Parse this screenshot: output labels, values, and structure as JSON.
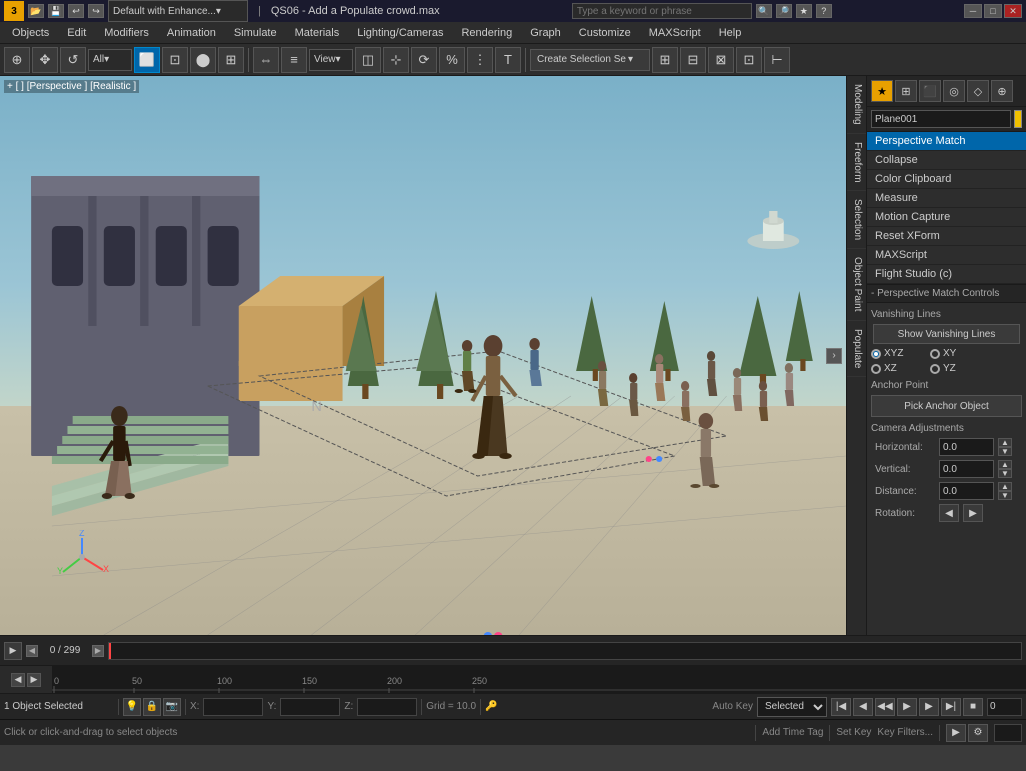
{
  "titlebar": {
    "app_label": "3",
    "profile_dropdown": "Default with Enhance...",
    "file_title": "QS06 - Add a Populate crowd.max",
    "search_placeholder": "Type a keyword or phrase",
    "minimize": "─",
    "maximize": "□",
    "close": "✕"
  },
  "menubar": {
    "items": [
      "Objects",
      "Edit",
      "Modifiers",
      "Animation",
      "Simulate",
      "Materials",
      "Lighting/Cameras",
      "Rendering",
      "Graph",
      "Customize",
      "MAXScript",
      "Help"
    ]
  },
  "toolbar": {
    "create_selection_label": "Create Selection Se",
    "dropdown_all": "All",
    "view_dropdown": "View"
  },
  "viewport": {
    "label": "+ [ ] [Perspective ] [Realistic ]"
  },
  "right_tabs": {
    "items": [
      "Modeling",
      "Freeform",
      "Selection",
      "Object Paint",
      "Populate"
    ]
  },
  "right_panel": {
    "object_name": "Plane001",
    "icons": [
      "★",
      "⊞",
      "⬛",
      "◎",
      "◇",
      "⊕"
    ],
    "menu_items": [
      {
        "label": "Perspective Match",
        "active": true
      },
      {
        "label": "Collapse",
        "active": false
      },
      {
        "label": "Color Clipboard",
        "active": false
      },
      {
        "label": "Measure",
        "active": false
      },
      {
        "label": "Motion Capture",
        "active": false
      },
      {
        "label": "Reset XForm",
        "active": false
      },
      {
        "label": "MAXScript",
        "active": false
      },
      {
        "label": "Flight Studio (c)",
        "active": false
      }
    ],
    "perspective_match_controls": {
      "section_label": "- Perspective Match Controls",
      "vanishing_lines_label": "Vanishing Lines",
      "show_button": "Show Vanishing Lines",
      "radio_items": [
        {
          "label": "XYZ",
          "checked": true
        },
        {
          "label": "XY",
          "checked": false
        },
        {
          "label": "XZ",
          "checked": false
        },
        {
          "label": "YZ",
          "checked": false
        }
      ],
      "anchor_label": "Anchor Point",
      "pick_anchor": "Pick Anchor Object",
      "camera_adj_label": "Camera Adjustments",
      "horizontal_label": "Horizontal:",
      "horizontal_val": "0.0",
      "vertical_label": "Vertical:",
      "vertical_val": "0.0",
      "distance_label": "Distance:",
      "distance_val": "0.0",
      "rotation_label": "Rotation:"
    }
  },
  "timeline": {
    "counter": "0 / 299",
    "frame_marks": [
      "0",
      "50",
      "100",
      "150",
      "200",
      "250"
    ]
  },
  "statusbar": {
    "object_selected": "1 Object Selected",
    "coord_x": "X:",
    "coord_y": "Y:",
    "coord_z": "Z:",
    "grid_info": "Grid = 10.0",
    "auto_key_label": "Auto Key",
    "selected_dropdown": "Selected",
    "set_key_label": "Set Key",
    "key_filters": "Key Filters...",
    "click_hint": "Click or click-and-drag to select objects",
    "add_time_tag": "Add Time Tag",
    "frame_num": "0"
  }
}
